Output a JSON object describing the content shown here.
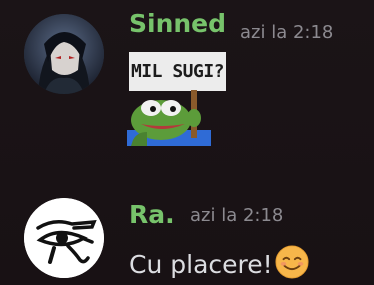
{
  "messages": [
    {
      "author": "Sinned",
      "author_color": "#77c36b",
      "timestamp": "azi la 2:18",
      "sticker_text": "MIL SUGI?",
      "sticker_name": "pepe-holding-sign-sticker"
    },
    {
      "author": "Ra.",
      "author_color": "#77c36b",
      "timestamp": "azi la 2:18",
      "text": "Cu placere!",
      "emoji_name": "smiling-face-emoji"
    }
  ]
}
